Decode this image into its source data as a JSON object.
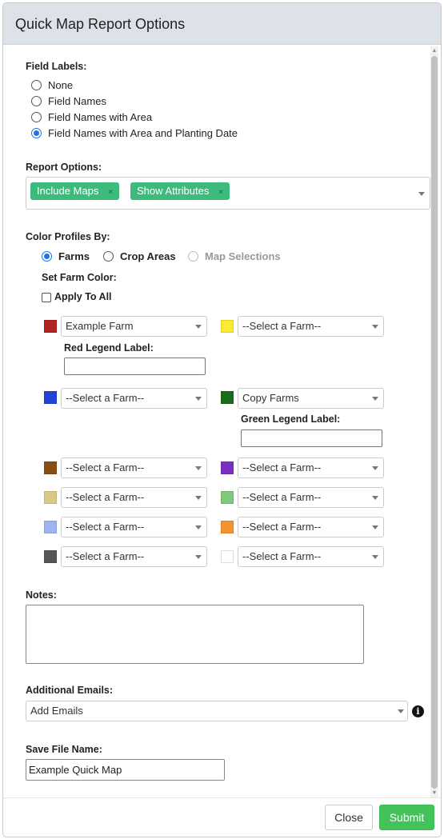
{
  "header": {
    "title": "Quick Map Report Options"
  },
  "field_labels": {
    "heading": "Field Labels:",
    "options": [
      {
        "label": "None",
        "checked": false
      },
      {
        "label": "Field Names",
        "checked": false
      },
      {
        "label": "Field Names with Area",
        "checked": false
      },
      {
        "label": "Field Names with Area and Planting Date",
        "checked": true
      }
    ]
  },
  "report_options": {
    "heading": "Report Options:",
    "tags": [
      {
        "label": "Include Maps",
        "remove": "×"
      },
      {
        "label": "Show Attributes",
        "remove": "×"
      }
    ]
  },
  "color_profiles": {
    "heading": "Color Profiles By:",
    "options": [
      {
        "label": "Farms",
        "checked": true,
        "disabled": false
      },
      {
        "label": "Crop Areas",
        "checked": false,
        "disabled": false
      },
      {
        "label": "Map Selections",
        "checked": false,
        "disabled": true
      }
    ],
    "set_farm_color": "Set Farm Color:",
    "apply_to_all": "Apply To All",
    "apply_to_all_checked": false
  },
  "farm_colors": [
    {
      "color": "#b22222",
      "value": "Example Farm",
      "legend_label": "Red Legend Label:"
    },
    {
      "color": "#fbeb2f",
      "value": "--Select a Farm--"
    },
    {
      "color": "#2243d6",
      "value": "--Select a Farm--"
    },
    {
      "color": "#1a6b1a",
      "value": "Copy Farms",
      "legend_label": "Green Legend Label:"
    },
    {
      "color": "#8b4c13",
      "value": "--Select a Farm--"
    },
    {
      "color": "#7b2ec2",
      "value": "--Select a Farm--"
    },
    {
      "color": "#dcc687",
      "value": "--Select a Farm--"
    },
    {
      "color": "#80c87c",
      "value": "--Select a Farm--"
    },
    {
      "color": "#9db3f2",
      "value": "--Select a Farm--"
    },
    {
      "color": "#f7902f",
      "value": "--Select a Farm--"
    },
    {
      "color": "#555555",
      "value": "--Select a Farm--"
    },
    {
      "color": "#ffffff",
      "value": "--Select a Farm--"
    }
  ],
  "notes": {
    "heading": "Notes:",
    "value": ""
  },
  "additional_emails": {
    "heading": "Additional Emails:",
    "placeholder": "Add Emails",
    "info_icon": "i"
  },
  "save_file": {
    "heading": "Save File Name:",
    "value": "Example Quick Map"
  },
  "footer": {
    "close_label": "Close",
    "submit_label": "Submit"
  },
  "colors": {
    "accent": "#1a73e8",
    "tag": "#3dbb7d",
    "submit": "#44c25a",
    "header_bg": "#dde2e8"
  }
}
